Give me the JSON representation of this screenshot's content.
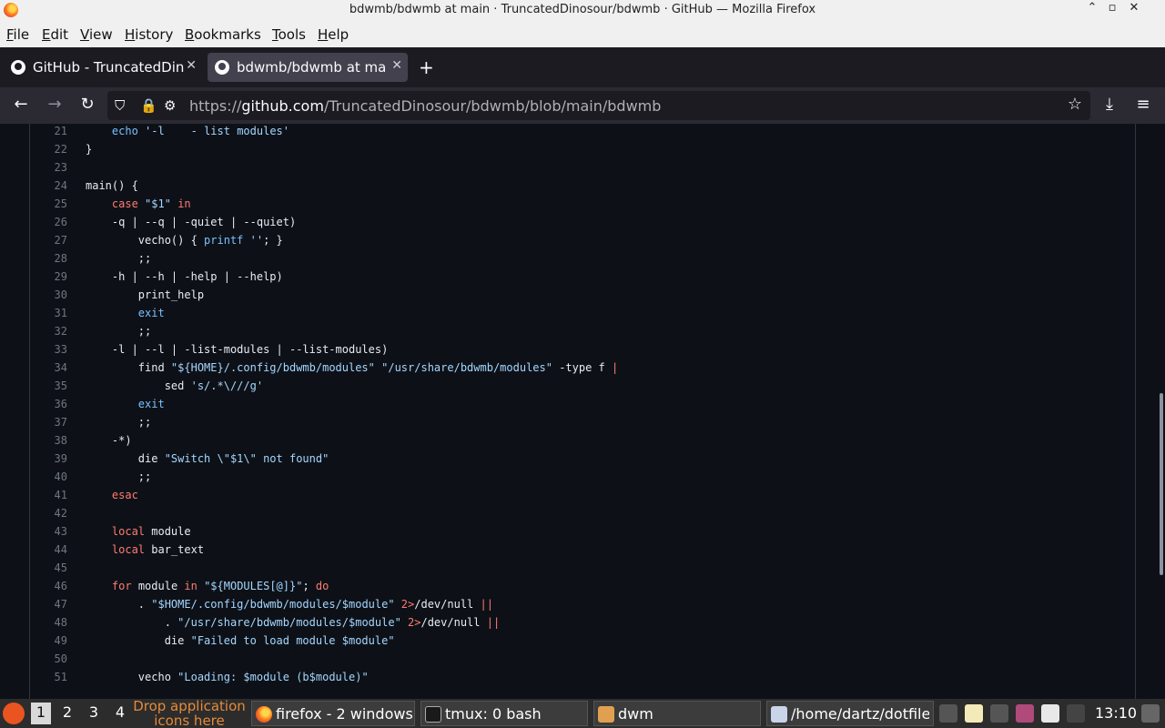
{
  "window": {
    "title": "bdwmb/bdwmb at main · TruncatedDinosour/bdwmb · GitHub — Mozilla Firefox",
    "minimize": "⌃",
    "maximize": "▫",
    "close": "✕"
  },
  "menu": [
    "File",
    "Edit",
    "View",
    "History",
    "Bookmarks",
    "Tools",
    "Help"
  ],
  "tabs": [
    {
      "label": "GitHub - TruncatedDinosour/bdwmb",
      "close": "✕"
    },
    {
      "label": "bdwmb/bdwmb at main",
      "close": "✕"
    }
  ],
  "new_tab": "+",
  "nav": {
    "back": "←",
    "forward": "→",
    "reload": "↻",
    "url_prefix": "https://",
    "url_host": "github.com",
    "url_path": "/TruncatedDinosour/bdwmb/blob/main/bdwmb",
    "bookmark": "☆",
    "downloads": "⤓",
    "menu": "≡"
  },
  "code_lines": [
    {
      "n": "21",
      "t": [
        [
          "    ",
          ""
        ],
        [
          "echo",
          "bi"
        ],
        [
          " ",
          ""
        ],
        [
          "'-l    - list modules'",
          "str"
        ]
      ]
    },
    {
      "n": "22",
      "t": [
        [
          "}",
          ""
        ]
      ]
    },
    {
      "n": "23",
      "t": []
    },
    {
      "n": "24",
      "t": [
        [
          "main() {",
          ""
        ]
      ]
    },
    {
      "n": "25",
      "t": [
        [
          "    ",
          ""
        ],
        [
          "case",
          "kw"
        ],
        [
          " ",
          ""
        ],
        [
          "\"$1\"",
          "str"
        ],
        [
          " ",
          ""
        ],
        [
          "in",
          "kw"
        ]
      ]
    },
    {
      "n": "26",
      "t": [
        [
          "    -q | --q | -quiet | --quiet)",
          ""
        ]
      ]
    },
    {
      "n": "27",
      "t": [
        [
          "        vecho() { ",
          ""
        ],
        [
          "printf",
          "bi"
        ],
        [
          " ",
          ""
        ],
        [
          "''",
          "str"
        ],
        [
          "; }",
          ""
        ]
      ]
    },
    {
      "n": "28",
      "t": [
        [
          "        ;;",
          ""
        ]
      ]
    },
    {
      "n": "29",
      "t": [
        [
          "    -h | --h | -help | --help)",
          ""
        ]
      ]
    },
    {
      "n": "30",
      "t": [
        [
          "        print_help",
          ""
        ]
      ]
    },
    {
      "n": "31",
      "t": [
        [
          "        ",
          ""
        ],
        [
          "exit",
          "bi"
        ]
      ]
    },
    {
      "n": "32",
      "t": [
        [
          "        ;;",
          ""
        ]
      ]
    },
    {
      "n": "33",
      "t": [
        [
          "    -l | --l | -list-modules | --list-modules)",
          ""
        ]
      ]
    },
    {
      "n": "34",
      "t": [
        [
          "        find ",
          ""
        ],
        [
          "\"${HOME}/.config/bdwmb/modules\"",
          "str"
        ],
        [
          " ",
          ""
        ],
        [
          "\"/usr/share/bdwmb/modules\"",
          "str"
        ],
        [
          " -type f ",
          ""
        ],
        [
          "|",
          "kw"
        ]
      ]
    },
    {
      "n": "35",
      "t": [
        [
          "            sed ",
          ""
        ],
        [
          "'s/.*\\///g'",
          "str"
        ]
      ]
    },
    {
      "n": "36",
      "t": [
        [
          "        ",
          ""
        ],
        [
          "exit",
          "bi"
        ]
      ]
    },
    {
      "n": "37",
      "t": [
        [
          "        ;;",
          ""
        ]
      ]
    },
    {
      "n": "38",
      "t": [
        [
          "    -*)",
          ""
        ]
      ]
    },
    {
      "n": "39",
      "t": [
        [
          "        die ",
          ""
        ],
        [
          "\"Switch \\\"$1\\\" not found\"",
          "str"
        ]
      ]
    },
    {
      "n": "40",
      "t": [
        [
          "        ;;",
          ""
        ]
      ]
    },
    {
      "n": "41",
      "t": [
        [
          "    ",
          ""
        ],
        [
          "esac",
          "kw"
        ]
      ]
    },
    {
      "n": "42",
      "t": []
    },
    {
      "n": "43",
      "t": [
        [
          "    ",
          ""
        ],
        [
          "local",
          "kw"
        ],
        [
          " module",
          ""
        ]
      ]
    },
    {
      "n": "44",
      "t": [
        [
          "    ",
          ""
        ],
        [
          "local",
          "kw"
        ],
        [
          " bar_text",
          ""
        ]
      ]
    },
    {
      "n": "45",
      "t": []
    },
    {
      "n": "46",
      "t": [
        [
          "    ",
          ""
        ],
        [
          "for",
          "kw"
        ],
        [
          " module ",
          ""
        ],
        [
          "in",
          "kw"
        ],
        [
          " ",
          ""
        ],
        [
          "\"${MODULES[@]}\"",
          "str"
        ],
        [
          "; ",
          ""
        ],
        [
          "do",
          "kw"
        ]
      ]
    },
    {
      "n": "47",
      "t": [
        [
          "        . ",
          ""
        ],
        [
          "\"$HOME/.config/bdwmb/modules/$module\"",
          "str"
        ],
        [
          " ",
          ""
        ],
        [
          "2>",
          "kw"
        ],
        [
          "/dev/null ",
          ""
        ],
        [
          "||",
          "kw"
        ]
      ]
    },
    {
      "n": "48",
      "t": [
        [
          "            . ",
          ""
        ],
        [
          "\"/usr/share/bdwmb/modules/$module\"",
          "str"
        ],
        [
          " ",
          ""
        ],
        [
          "2>",
          "kw"
        ],
        [
          "/dev/null ",
          ""
        ],
        [
          "||",
          "kw"
        ]
      ]
    },
    {
      "n": "49",
      "t": [
        [
          "            die ",
          ""
        ],
        [
          "\"Failed to load module $module\"",
          "str"
        ]
      ]
    },
    {
      "n": "50",
      "t": []
    },
    {
      "n": "51",
      "t": [
        [
          "        vecho ",
          ""
        ],
        [
          "\"Loading: $module (b$module)\"",
          "str"
        ]
      ]
    }
  ],
  "taskbar": {
    "workspaces": [
      "1",
      "2",
      "3",
      "4"
    ],
    "current_workspace": "1",
    "drop_hint": "Drop application icons here",
    "tasks": [
      {
        "label": "firefox - 2 windows",
        "icon": "firefox-icon"
      },
      {
        "label": "tmux: 0 bash",
        "icon": "terminal-icon"
      },
      {
        "label": "dwm",
        "icon": "folder-icon"
      },
      {
        "label": "/home/dartz/dotfiles",
        "icon": "editor-icon"
      }
    ],
    "clock": "13:10"
  },
  "colors": {
    "background": "#0d1117",
    "keyword": "#ff7b72",
    "string": "#a5d6ff",
    "builtin": "#79c0ff",
    "line_number": "#6e7681"
  }
}
